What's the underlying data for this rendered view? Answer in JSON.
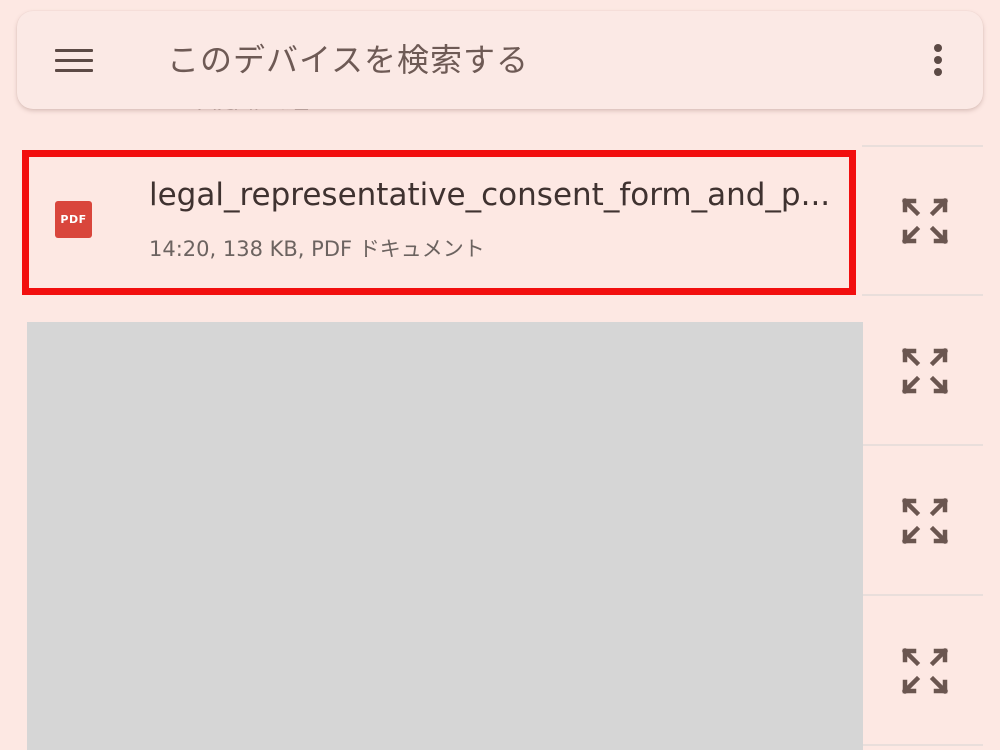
{
  "search_bar": {
    "menu_icon": "hamburger-menu-icon",
    "placeholder": "このデバイスを検索する",
    "more_icon": "more-vertical-icon"
  },
  "peek_text": "ファイル 今日",
  "files": [
    {
      "icon": "pdf-icon",
      "icon_label": "PDF",
      "name": "legal_representative_consent_form_and_p...",
      "meta": "14:20, 138 KB, PDF ドキュメント",
      "highlighted": true
    },
    {
      "thumbnail": "gray-thumbnail-placeholder"
    }
  ],
  "row_actions": {
    "icon": "expand-icon",
    "count": 4
  },
  "colors": {
    "background": "#fde8e3",
    "search_bar": "#fbe9e5",
    "highlight": "#f20f0f",
    "pdf_red": "#d9463c",
    "icon": "#6b5650",
    "thumbnail_gray": "#d6d6d6"
  }
}
